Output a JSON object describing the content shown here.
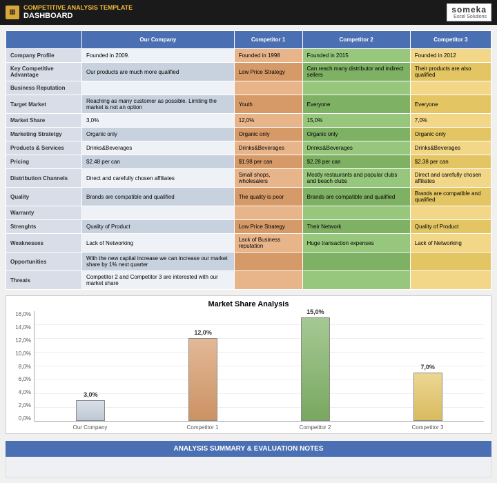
{
  "header": {
    "supertitle": "COMPETITIVE ANALYSIS TEMPLATE",
    "title": "DASHBOARD",
    "brand_name": "someka",
    "brand_sub": "Excel Solutions"
  },
  "columns": [
    "",
    "Our Company",
    "Competitor 1",
    "Competitor 2",
    "Competitor 3"
  ],
  "rows": [
    {
      "label": "Company Profile",
      "hi": false,
      "cells": [
        "Founded in 2009.",
        "Founded in 1998",
        "Founded in 2015",
        "Founded in 2012"
      ]
    },
    {
      "label": "Key Competitive Advantage",
      "hi": true,
      "cells": [
        "Our products are much more qualified",
        "Low Price Strategy",
        "Can reach many distributor and indirect sellers",
        "Their products are also qualified"
      ]
    },
    {
      "label": "Business Reputation",
      "hi": false,
      "cells": [
        "",
        "",
        "",
        ""
      ]
    },
    {
      "label": "Target Market",
      "hi": true,
      "cells": [
        "Reaching as many customer as possible. Limiting the market is not an option",
        "Youth",
        "Everyone",
        "Everyone"
      ]
    },
    {
      "label": "Market Share",
      "hi": false,
      "cells": [
        "3,0%",
        "12,0%",
        "15,0%",
        "7,0%"
      ]
    },
    {
      "label": "Marketing Stratetgy",
      "hi": true,
      "cells": [
        "Organic only",
        "Organic only",
        "Organic only",
        "Organic only"
      ]
    },
    {
      "label": "Products & Services",
      "hi": false,
      "cells": [
        "Drinks&Beverages",
        "Drinks&Beverages",
        "Drinks&Beverages",
        "Drinks&Beverages"
      ]
    },
    {
      "label": "Pricing",
      "hi": true,
      "cells": [
        "$2.48 per can",
        "$1.98 per can",
        "$2.28 per can",
        "$2.38 per can"
      ]
    },
    {
      "label": "Distribution Channels",
      "hi": false,
      "cells": [
        "Direct and carefully chosen affiliates",
        "Small shops, wholesalers",
        "Mostly restaurants and popular clubs and beach clubs",
        "Direct and carefully chosen affiliates"
      ]
    },
    {
      "label": "Quality",
      "hi": true,
      "cells": [
        "Brands are compatible and qualified",
        "The quality is poor",
        "Brands are compatible and qualified",
        "Brands are compatible and qualified"
      ]
    },
    {
      "label": "Warranty",
      "hi": false,
      "cells": [
        "",
        "",
        "",
        ""
      ]
    },
    {
      "label": "Strenghts",
      "hi": true,
      "cells": [
        "Quality of Product",
        "Low Price Strategy",
        "Their Network",
        "Quality of Product"
      ]
    },
    {
      "label": "Weaknesses",
      "hi": false,
      "cells": [
        "Lack of Networking",
        "Lack of  Business reputation",
        "Huge transaction expenses",
        "Lack of Networking"
      ]
    },
    {
      "label": "Opportunities",
      "hi": true,
      "cells": [
        "With the new capital increase we can increase our market share by 1% next quarter",
        "",
        "",
        ""
      ]
    },
    {
      "label": "Threats",
      "hi": false,
      "cells": [
        "Competitor 2 and Competitor 3 are interested with our market share",
        "",
        "",
        ""
      ]
    }
  ],
  "chart_data": {
    "type": "bar",
    "title": "Market Share Analysis",
    "categories": [
      "Our Company",
      "Competitor 1",
      "Competitor 2",
      "Competitor 3"
    ],
    "values": [
      3.0,
      12.0,
      15.0,
      7.0
    ],
    "value_labels": [
      "3,0%",
      "12,0%",
      "15,0%",
      "7,0%"
    ],
    "ylim": [
      0,
      16
    ],
    "ytick_labels": [
      "16,0%",
      "14,0%",
      "12,0%",
      "10,0%",
      "8,0%",
      "6,0%",
      "4,0%",
      "2,0%",
      "0,0%"
    ],
    "colors": [
      "#c8d2df",
      "#d69a69",
      "#7fb165",
      "#e4c564"
    ]
  },
  "summary": {
    "title": "ANALYSIS SUMMARY & EVALUATION NOTES"
  }
}
